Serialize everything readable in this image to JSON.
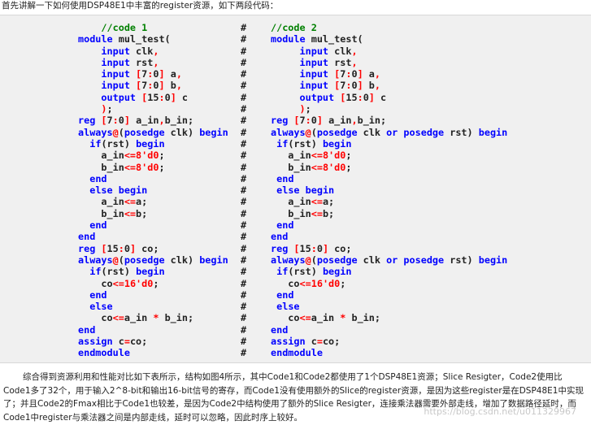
{
  "intro": "首先讲解一下如何使用DSP48E1中丰富的register资源，如下两段代码：",
  "separator": "#",
  "colors": {
    "keyword": "#0000ff",
    "operator": "#ff0000",
    "comment": "#008000",
    "text": "#222222",
    "code_bg": "#f0f0f0"
  },
  "code_left": [
    [
      [
        "cm",
        "    //code 1"
      ]
    ],
    [
      [
        "kw",
        "module"
      ],
      [
        "tx",
        " mul_test("
      ]
    ],
    [
      [
        "tx",
        "    "
      ],
      [
        "kw",
        "input"
      ],
      [
        "tx",
        " clk"
      ],
      [
        "op",
        ","
      ]
    ],
    [
      [
        "tx",
        "    "
      ],
      [
        "kw",
        "input"
      ],
      [
        "tx",
        " rst"
      ],
      [
        "op",
        ","
      ]
    ],
    [
      [
        "tx",
        "    "
      ],
      [
        "kw",
        "input"
      ],
      [
        "tx",
        " "
      ],
      [
        "op",
        "["
      ],
      [
        "tx",
        "7"
      ],
      [
        "op",
        ":"
      ],
      [
        "tx",
        "0"
      ],
      [
        "op",
        "]"
      ],
      [
        "tx",
        " a"
      ],
      [
        "op",
        ","
      ]
    ],
    [
      [
        "tx",
        "    "
      ],
      [
        "kw",
        "input"
      ],
      [
        "tx",
        " "
      ],
      [
        "op",
        "["
      ],
      [
        "tx",
        "7"
      ],
      [
        "op",
        ":"
      ],
      [
        "tx",
        "0"
      ],
      [
        "op",
        "]"
      ],
      [
        "tx",
        " b"
      ],
      [
        "op",
        ","
      ]
    ],
    [
      [
        "tx",
        "    "
      ],
      [
        "kw",
        "output"
      ],
      [
        "tx",
        " "
      ],
      [
        "op",
        "["
      ],
      [
        "tx",
        "15"
      ],
      [
        "op",
        ":"
      ],
      [
        "tx",
        "0"
      ],
      [
        "op",
        "]"
      ],
      [
        "tx",
        " c"
      ]
    ],
    [
      [
        "tx",
        "    "
      ],
      [
        "op",
        ")"
      ],
      [
        "tx",
        ";"
      ]
    ],
    [
      [
        "kw",
        "reg"
      ],
      [
        "tx",
        " "
      ],
      [
        "op",
        "["
      ],
      [
        "tx",
        "7"
      ],
      [
        "op",
        ":"
      ],
      [
        "tx",
        "0"
      ],
      [
        "op",
        "]"
      ],
      [
        "tx",
        " a_in"
      ],
      [
        "op",
        ","
      ],
      [
        "tx",
        "b_in;"
      ]
    ],
    [
      [
        "kw",
        "always"
      ],
      [
        "op",
        "@"
      ],
      [
        "tx",
        "("
      ],
      [
        "kw",
        "posedge"
      ],
      [
        "tx",
        " clk) "
      ],
      [
        "kw",
        "begin"
      ]
    ],
    [
      [
        "tx",
        "  "
      ],
      [
        "kw",
        "if"
      ],
      [
        "tx",
        "(rst) "
      ],
      [
        "kw",
        "begin"
      ]
    ],
    [
      [
        "tx",
        "    a_in"
      ],
      [
        "op",
        "<="
      ],
      [
        "op",
        "8'd0"
      ],
      [
        "tx",
        ";"
      ]
    ],
    [
      [
        "tx",
        "    b_in"
      ],
      [
        "op",
        "<="
      ],
      [
        "op",
        "8'd0"
      ],
      [
        "tx",
        ";"
      ]
    ],
    [
      [
        "tx",
        "  "
      ],
      [
        "kw",
        "end"
      ]
    ],
    [
      [
        "tx",
        "  "
      ],
      [
        "kw",
        "else"
      ],
      [
        "tx",
        " "
      ],
      [
        "kw",
        "begin"
      ]
    ],
    [
      [
        "tx",
        "    a_in"
      ],
      [
        "op",
        "<="
      ],
      [
        "tx",
        "a;"
      ]
    ],
    [
      [
        "tx",
        "    b_in"
      ],
      [
        "op",
        "<="
      ],
      [
        "tx",
        "b;"
      ]
    ],
    [
      [
        "tx",
        "  "
      ],
      [
        "kw",
        "end"
      ]
    ],
    [
      [
        "kw",
        "end"
      ]
    ],
    [
      [
        "kw",
        "reg"
      ],
      [
        "tx",
        " "
      ],
      [
        "op",
        "["
      ],
      [
        "tx",
        "15"
      ],
      [
        "op",
        ":"
      ],
      [
        "tx",
        "0"
      ],
      [
        "op",
        "]"
      ],
      [
        "tx",
        " co;"
      ]
    ],
    [
      [
        "kw",
        "always"
      ],
      [
        "op",
        "@"
      ],
      [
        "tx",
        "("
      ],
      [
        "kw",
        "posedge"
      ],
      [
        "tx",
        " clk) "
      ],
      [
        "kw",
        "begin"
      ]
    ],
    [
      [
        "tx",
        "  "
      ],
      [
        "kw",
        "if"
      ],
      [
        "tx",
        "(rst) "
      ],
      [
        "kw",
        "begin"
      ]
    ],
    [
      [
        "tx",
        "    co"
      ],
      [
        "op",
        "<="
      ],
      [
        "op",
        "16'd0"
      ],
      [
        "tx",
        ";"
      ]
    ],
    [
      [
        "tx",
        "  "
      ],
      [
        "kw",
        "end"
      ]
    ],
    [
      [
        "tx",
        "  "
      ],
      [
        "kw",
        "else"
      ]
    ],
    [
      [
        "tx",
        "    co"
      ],
      [
        "op",
        "<="
      ],
      [
        "tx",
        "a_in "
      ],
      [
        "op",
        "*"
      ],
      [
        "tx",
        " b_in;"
      ]
    ],
    [
      [
        "kw",
        "end"
      ]
    ],
    [
      [
        "kw",
        "assign"
      ],
      [
        "tx",
        " c"
      ],
      [
        "op",
        "="
      ],
      [
        "tx",
        "co;"
      ]
    ],
    [
      [
        "kw",
        "endmodule"
      ]
    ]
  ],
  "code_right": [
    [
      [
        "cm",
        "//code 2"
      ]
    ],
    [
      [
        "kw",
        "module"
      ],
      [
        "tx",
        " mul_test("
      ]
    ],
    [
      [
        "tx",
        "     "
      ],
      [
        "kw",
        "input"
      ],
      [
        "tx",
        " clk"
      ],
      [
        "op",
        ","
      ]
    ],
    [
      [
        "tx",
        "     "
      ],
      [
        "kw",
        "input"
      ],
      [
        "tx",
        " rst"
      ],
      [
        "op",
        ","
      ]
    ],
    [
      [
        "tx",
        "     "
      ],
      [
        "kw",
        "input"
      ],
      [
        "tx",
        " "
      ],
      [
        "op",
        "["
      ],
      [
        "tx",
        "7"
      ],
      [
        "op",
        ":"
      ],
      [
        "tx",
        "0"
      ],
      [
        "op",
        "]"
      ],
      [
        "tx",
        " a"
      ],
      [
        "op",
        ","
      ]
    ],
    [
      [
        "tx",
        "     "
      ],
      [
        "kw",
        "input"
      ],
      [
        "tx",
        " "
      ],
      [
        "op",
        "["
      ],
      [
        "tx",
        "7"
      ],
      [
        "op",
        ":"
      ],
      [
        "tx",
        "0"
      ],
      [
        "op",
        "]"
      ],
      [
        "tx",
        " b"
      ],
      [
        "op",
        ","
      ]
    ],
    [
      [
        "tx",
        "     "
      ],
      [
        "kw",
        "output"
      ],
      [
        "tx",
        " "
      ],
      [
        "op",
        "["
      ],
      [
        "tx",
        "15"
      ],
      [
        "op",
        ":"
      ],
      [
        "tx",
        "0"
      ],
      [
        "op",
        "]"
      ],
      [
        "tx",
        " c"
      ]
    ],
    [
      [
        "tx",
        "     "
      ],
      [
        "op",
        ")"
      ],
      [
        "tx",
        ";"
      ]
    ],
    [
      [
        "kw",
        "reg"
      ],
      [
        "tx",
        " "
      ],
      [
        "op",
        "["
      ],
      [
        "tx",
        "7"
      ],
      [
        "op",
        ":"
      ],
      [
        "tx",
        "0"
      ],
      [
        "op",
        "]"
      ],
      [
        "tx",
        " a_in"
      ],
      [
        "op",
        ","
      ],
      [
        "tx",
        "b_in;"
      ]
    ],
    [
      [
        "kw",
        "always"
      ],
      [
        "op",
        "@"
      ],
      [
        "tx",
        "("
      ],
      [
        "kw",
        "posedge"
      ],
      [
        "tx",
        " clk "
      ],
      [
        "kw",
        "or"
      ],
      [
        "tx",
        " "
      ],
      [
        "kw",
        "posedge"
      ],
      [
        "tx",
        " rst) "
      ],
      [
        "kw",
        "begin"
      ]
    ],
    [
      [
        "tx",
        " "
      ],
      [
        "kw",
        "if"
      ],
      [
        "tx",
        "(rst) "
      ],
      [
        "kw",
        "begin"
      ]
    ],
    [
      [
        "tx",
        "   a_in"
      ],
      [
        "op",
        "<="
      ],
      [
        "op",
        "8'd0"
      ],
      [
        "tx",
        ";"
      ]
    ],
    [
      [
        "tx",
        "   b_in"
      ],
      [
        "op",
        "<="
      ],
      [
        "op",
        "8'd0"
      ],
      [
        "tx",
        ";"
      ]
    ],
    [
      [
        "tx",
        " "
      ],
      [
        "kw",
        "end"
      ]
    ],
    [
      [
        "tx",
        " "
      ],
      [
        "kw",
        "else"
      ],
      [
        "tx",
        " "
      ],
      [
        "kw",
        "begin"
      ]
    ],
    [
      [
        "tx",
        "   a_in"
      ],
      [
        "op",
        "<="
      ],
      [
        "tx",
        "a;"
      ]
    ],
    [
      [
        "tx",
        "   b_in"
      ],
      [
        "op",
        "<="
      ],
      [
        "tx",
        "b;"
      ]
    ],
    [
      [
        "tx",
        " "
      ],
      [
        "kw",
        "end"
      ]
    ],
    [
      [
        "kw",
        "end"
      ]
    ],
    [
      [
        "kw",
        "reg"
      ],
      [
        "tx",
        " "
      ],
      [
        "op",
        "["
      ],
      [
        "tx",
        "15"
      ],
      [
        "op",
        ":"
      ],
      [
        "tx",
        "0"
      ],
      [
        "op",
        "]"
      ],
      [
        "tx",
        " co;"
      ]
    ],
    [
      [
        "kw",
        "always"
      ],
      [
        "op",
        "@"
      ],
      [
        "tx",
        "("
      ],
      [
        "kw",
        "posedge"
      ],
      [
        "tx",
        " clk "
      ],
      [
        "kw",
        "or"
      ],
      [
        "tx",
        " "
      ],
      [
        "kw",
        "posedge"
      ],
      [
        "tx",
        " rst) "
      ],
      [
        "kw",
        "begin"
      ]
    ],
    [
      [
        "tx",
        " "
      ],
      [
        "kw",
        "if"
      ],
      [
        "tx",
        "(rst) "
      ],
      [
        "kw",
        "begin"
      ]
    ],
    [
      [
        "tx",
        "   co"
      ],
      [
        "op",
        "<="
      ],
      [
        "op",
        "16'd0"
      ],
      [
        "tx",
        ";"
      ]
    ],
    [
      [
        "tx",
        " "
      ],
      [
        "kw",
        "end"
      ]
    ],
    [
      [
        "tx",
        " "
      ],
      [
        "kw",
        "else"
      ]
    ],
    [
      [
        "tx",
        "   co"
      ],
      [
        "op",
        "<="
      ],
      [
        "tx",
        "a_in "
      ],
      [
        "op",
        "*"
      ],
      [
        "tx",
        " b_in;"
      ]
    ],
    [
      [
        "kw",
        "end"
      ]
    ],
    [
      [
        "kw",
        "assign"
      ],
      [
        "tx",
        " c"
      ],
      [
        "op",
        "="
      ],
      [
        "tx",
        "co;"
      ]
    ],
    [
      [
        "kw",
        "endmodule"
      ]
    ]
  ],
  "summary": "综合得到资源利用和性能对比如下表所示，结构如图4所示，其中Code1和Code2都使用了1个DSP48E1资源；Slice Resigter，Code2使用比Code1多了32个，用于输入2^8-bit和输出16-bit信号的寄存，而Code1没有使用额外的Slice的register资源，是因为这些register是在DSP48E1中实现了；并且Code2的Fmax相比于Code1也较差，是因为Code2中结构使用了额外的Slice Resigter，连接乘法器需要外部走线，增加了数据路径延时，而Code1中register与乘法器之间是内部走线，延时可以忽略，因此时序上较好。",
  "watermark": "https://blog.csdn.net/u011329967"
}
